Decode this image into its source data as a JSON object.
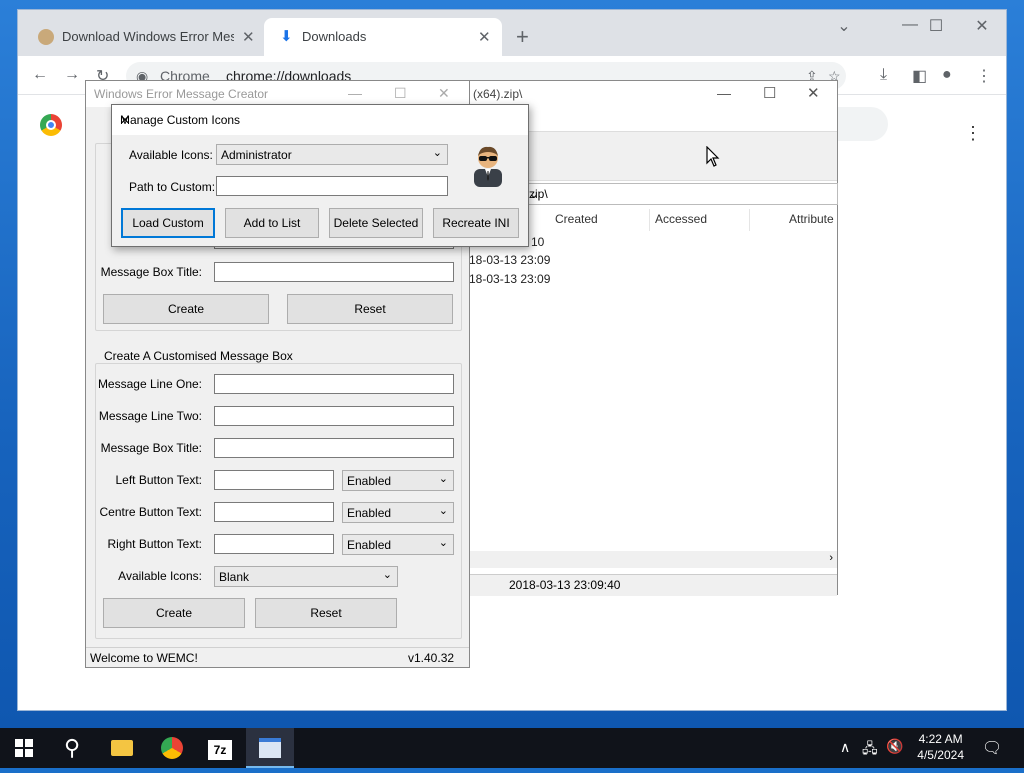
{
  "chrome": {
    "tabs": [
      {
        "title": "Download Windows Error Messa"
      },
      {
        "title": "Downloads"
      }
    ],
    "omnibox": {
      "site": "Chrome",
      "url": "chrome://downloads"
    }
  },
  "sevenzip": {
    "title_fragment": "(x64).zip\\",
    "path": "zip\\",
    "columns": [
      "Created",
      "Accessed",
      "Attribute"
    ],
    "rows": [
      "10",
      "18-03-13 23:09",
      "18-03-13 23:09"
    ],
    "status": "2018-03-13 23:09:40"
  },
  "wemc": {
    "title": "Windows Error Message Creator",
    "top_group": {
      "title_label": "Message Box Title:",
      "create": "Create",
      "reset": "Reset"
    },
    "custom_group": {
      "caption": "Create A Customised Message Box",
      "line_one": "Message Line One:",
      "line_two": "Message Line Two:",
      "box_title": "Message Box Title:",
      "left_btn": "Left Button Text:",
      "centre_btn": "Centre Button Text:",
      "right_btn": "Right Button Text:",
      "left_state": "Enabled",
      "centre_state": "Enabled",
      "right_state": "Enabled",
      "icons_label": "Available Icons:",
      "icons_value": "Blank",
      "create": "Create",
      "reset": "Reset"
    },
    "status_left": "Welcome to WEMC!",
    "version": "v1.40.32"
  },
  "dialog": {
    "title": "Manage Custom Icons",
    "available_label": "Available Icons:",
    "available_value": "Administrator",
    "path_label": "Path to Custom:",
    "buttons": [
      "Load Custom",
      "Add to List",
      "Delete Selected",
      "Recreate INI"
    ]
  },
  "taskbar": {
    "time": "4:22 AM",
    "date": "4/5/2024"
  }
}
